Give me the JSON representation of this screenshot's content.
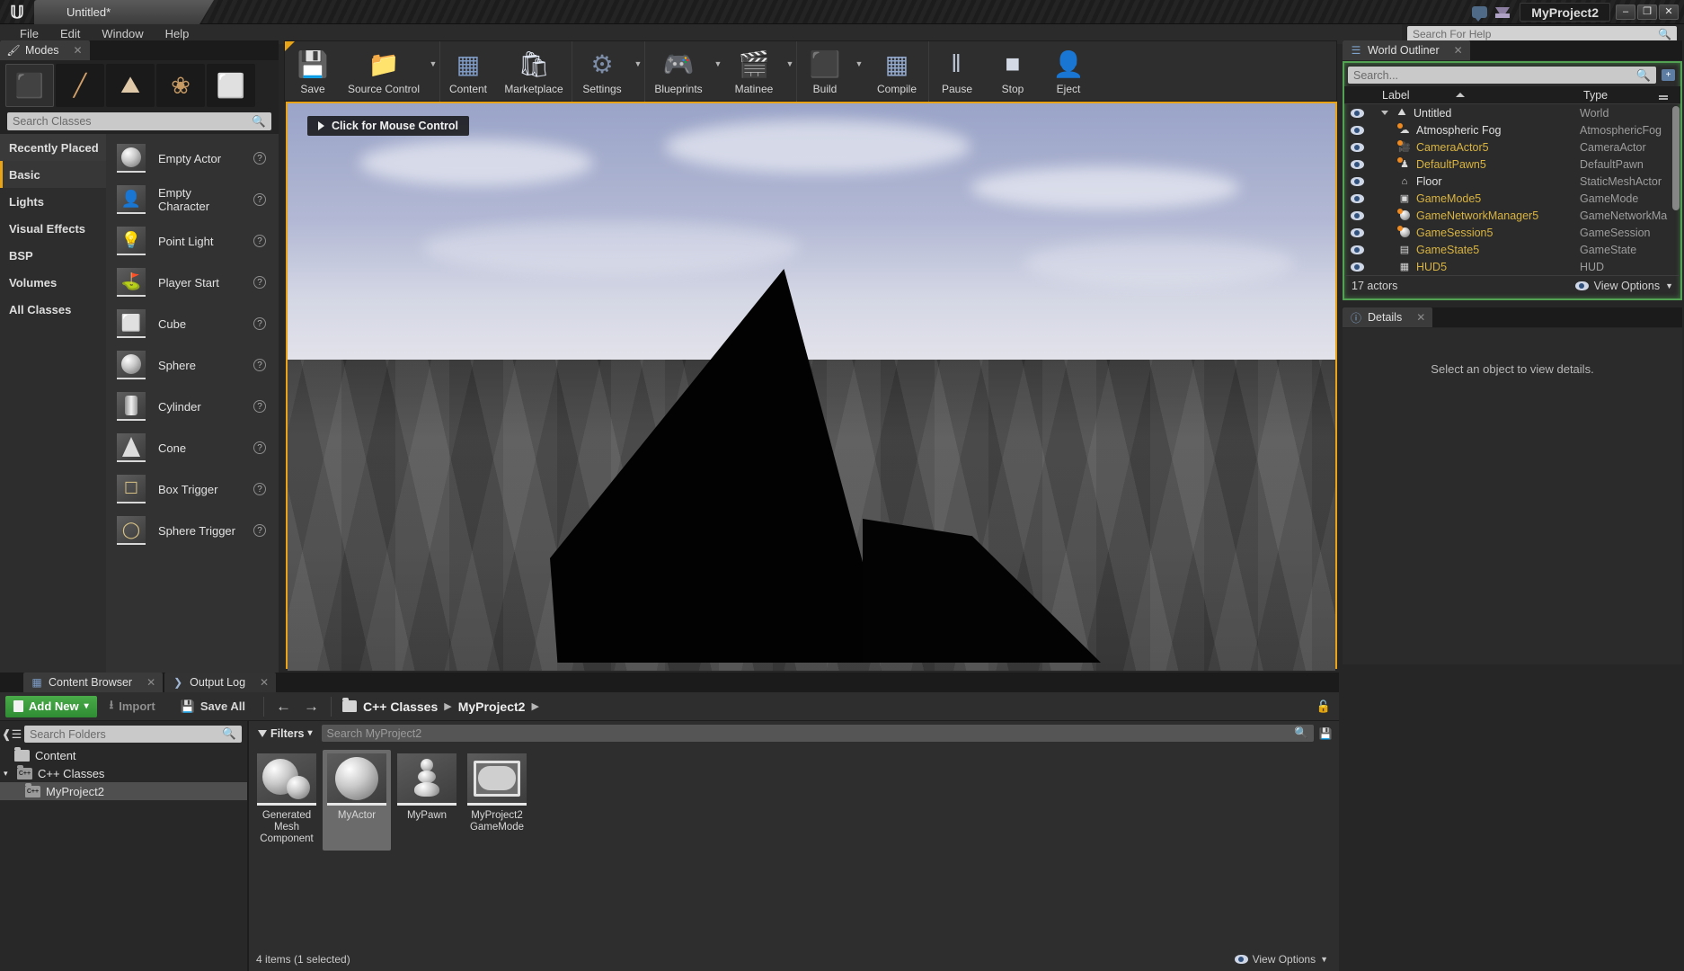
{
  "titlebar": {
    "tab_label": "Untitled*",
    "project_name": "MyProject2",
    "logo": "unreal-logo",
    "minimize": "–",
    "restore": "❐",
    "close": "✕"
  },
  "menubar": {
    "items": [
      "File",
      "Edit",
      "Window",
      "Help"
    ],
    "help_search_placeholder": "Search For Help"
  },
  "modes": {
    "tab_label": "Modes",
    "close_label": "✕",
    "mode_buttons": [
      {
        "name": "place-mode",
        "glyph": "⬛",
        "active": true
      },
      {
        "name": "paint-mode",
        "glyph": "╱"
      },
      {
        "name": "landscape-mode",
        "glyph": "⛰"
      },
      {
        "name": "foliage-mode",
        "glyph": "❀"
      },
      {
        "name": "geometry-editing-mode",
        "glyph": "⬜"
      }
    ],
    "search_placeholder": "Search Classes",
    "categories": [
      {
        "label": "Recently Placed",
        "state": "recent"
      },
      {
        "label": "Basic",
        "state": "active"
      },
      {
        "label": "Lights",
        "state": ""
      },
      {
        "label": "Visual Effects",
        "state": ""
      },
      {
        "label": "BSP",
        "state": ""
      },
      {
        "label": "Volumes",
        "state": ""
      },
      {
        "label": "All Classes",
        "state": ""
      }
    ],
    "actors": [
      {
        "label": "Empty Actor",
        "icon": "sphere-thumb"
      },
      {
        "label": "Empty Character",
        "icon": "character-thumb"
      },
      {
        "label": "Point Light",
        "icon": "bulb-thumb"
      },
      {
        "label": "Player Start",
        "icon": "flag-thumb"
      },
      {
        "label": "Cube",
        "icon": "cube-thumb"
      },
      {
        "label": "Sphere",
        "icon": "sphere-thumb"
      },
      {
        "label": "Cylinder",
        "icon": "cylinder-thumb"
      },
      {
        "label": "Cone",
        "icon": "cone-thumb"
      },
      {
        "label": "Box Trigger",
        "icon": "box-trigger-thumb"
      },
      {
        "label": "Sphere Trigger",
        "icon": "sphere-trigger-thumb"
      }
    ]
  },
  "toolbar": {
    "groups": [
      {
        "buttons": [
          {
            "label": "Save",
            "icon": "save-disk-icon",
            "glyph": "💾",
            "arrow": false
          },
          {
            "label": "Source Control",
            "icon": "source-control-icon",
            "glyph": "📂",
            "arrow": true,
            "wide": true
          }
        ]
      },
      {
        "buttons": [
          {
            "label": "Content",
            "icon": "content-grid-icon",
            "glyph": "▦",
            "arrow": false
          },
          {
            "label": "Marketplace",
            "icon": "marketplace-bag-icon",
            "glyph": "🛍",
            "arrow": false,
            "wide": true
          }
        ]
      },
      {
        "buttons": [
          {
            "label": "Settings",
            "icon": "settings-gear-icon",
            "glyph": "⚙",
            "arrow": true
          }
        ]
      },
      {
        "buttons": [
          {
            "label": "Blueprints",
            "icon": "blueprint-gamepad-icon",
            "glyph": "🎮",
            "arrow": true
          },
          {
            "label": "Matinee",
            "icon": "matinee-clapper-icon",
            "glyph": "🎬",
            "arrow": true
          }
        ]
      },
      {
        "buttons": [
          {
            "label": "Build",
            "icon": "build-cube-icon",
            "glyph": "⬛",
            "arrow": true
          },
          {
            "label": "Compile",
            "icon": "compile-cubes-icon",
            "glyph": "▒",
            "arrow": false
          }
        ]
      },
      {
        "buttons": [
          {
            "label": "Pause",
            "icon": "pause-icon",
            "glyph": "‖",
            "arrow": false
          },
          {
            "label": "Stop",
            "icon": "stop-icon",
            "glyph": "■",
            "arrow": false
          },
          {
            "label": "Eject",
            "icon": "eject-person-icon",
            "glyph": "👤",
            "arrow": false
          }
        ]
      }
    ]
  },
  "viewport": {
    "mouse_control_label": "Click for Mouse Control",
    "border_color": "#e8a317"
  },
  "outliner": {
    "tab_label": "World Outliner",
    "close_label": "✕",
    "search_placeholder": "Search...",
    "col_label": "Label",
    "col_type": "Type",
    "rows": [
      {
        "label": "Untitled",
        "type": "World",
        "depth": 0,
        "color": "white",
        "root": true,
        "icon": "world-icon",
        "glyph": "🌎",
        "dot": false
      },
      {
        "label": "Atmospheric Fog",
        "type": "AtmosphericFog",
        "depth": 1,
        "color": "white",
        "icon": "fog-icon",
        "glyph": "☁",
        "dot": true
      },
      {
        "label": "CameraActor5",
        "type": "CameraActor",
        "depth": 1,
        "color": "yellow",
        "icon": "camera-icon",
        "glyph": "🎥",
        "dot": true
      },
      {
        "label": "DefaultPawn5",
        "type": "DefaultPawn",
        "depth": 1,
        "color": "yellow",
        "icon": "pawn-icon",
        "glyph": "⚿",
        "dot": true
      },
      {
        "label": "Floor",
        "type": "StaticMeshActor",
        "depth": 1,
        "color": "white",
        "icon": "static-mesh-icon",
        "glyph": "⌂",
        "dot": false
      },
      {
        "label": "GameMode5",
        "type": "GameMode",
        "depth": 1,
        "color": "yellow",
        "icon": "gamemode-icon",
        "glyph": "▣",
        "dot": false
      },
      {
        "label": "GameNetworkManager5",
        "type": "GameNetworkMa",
        "depth": 1,
        "color": "yellow",
        "icon": "sphere-icon",
        "glyph": "●",
        "dot": true
      },
      {
        "label": "GameSession5",
        "type": "GameSession",
        "depth": 1,
        "color": "yellow",
        "icon": "sphere-icon",
        "glyph": "●",
        "dot": true
      },
      {
        "label": "GameState5",
        "type": "GameState",
        "depth": 1,
        "color": "yellow",
        "icon": "gamestate-icon",
        "glyph": "▤",
        "dot": false
      },
      {
        "label": "HUD5",
        "type": "HUD",
        "depth": 1,
        "color": "yellow",
        "icon": "hud-icon",
        "glyph": "▦",
        "dot": false
      }
    ],
    "footer_count": "17 actors",
    "view_options": "View Options"
  },
  "details": {
    "tab_label": "Details",
    "close_label": "✕",
    "empty_message": "Select an object to view details."
  },
  "content_browser": {
    "tabs": [
      {
        "label": "Content Browser",
        "icon": "content-browser-icon",
        "active": true
      },
      {
        "label": "Output Log",
        "icon": "output-log-icon",
        "active": false
      }
    ],
    "close_label": "✕",
    "add_new": "Add New",
    "add_new_caret": "▾",
    "import": "Import",
    "save_all": "Save All",
    "back_arrow": "←",
    "forward_arrow": "→",
    "breadcrumbs": [
      "C++ Classes",
      "MyProject2"
    ],
    "crumb_sep": "▶",
    "lock_icon": "lock-icon",
    "folder_search_placeholder": "Search Folders",
    "tree": [
      {
        "label": "Content",
        "depth": 0,
        "type": "folder",
        "selected": false,
        "expander": ""
      },
      {
        "label": "C++ Classes",
        "depth": 0,
        "type": "cpp-folder",
        "selected": false,
        "expander": "▾"
      },
      {
        "label": "MyProject2",
        "depth": 1,
        "type": "cpp-folder",
        "selected": true,
        "expander": ""
      }
    ],
    "filters_label": "Filters",
    "filters_caret": "▾",
    "asset_search_placeholder": "Search MyProject2",
    "assets": [
      {
        "name": "Generated\nMesh\nComponent",
        "display": "Generated Mesh Component",
        "thumb": "two-spheres-thumb",
        "selected": false
      },
      {
        "name": "MyActor",
        "display": "MyActor",
        "thumb": "sphere-thumb",
        "selected": true
      },
      {
        "name": "MyPawn",
        "display": "MyPawn",
        "thumb": "pawn-thumb",
        "selected": false
      },
      {
        "name": "MyProject2\nGameMode",
        "display": "MyProject2 GameMode",
        "thumb": "gamemode-thumb",
        "selected": false
      }
    ],
    "status": "4 items (1 selected)",
    "view_options": "View Options"
  },
  "colors": {
    "accent_orange": "#e8a317",
    "outliner_green": "#53a153",
    "add_new_green": "#3d9a3f",
    "yellow_text": "#d9b441"
  }
}
